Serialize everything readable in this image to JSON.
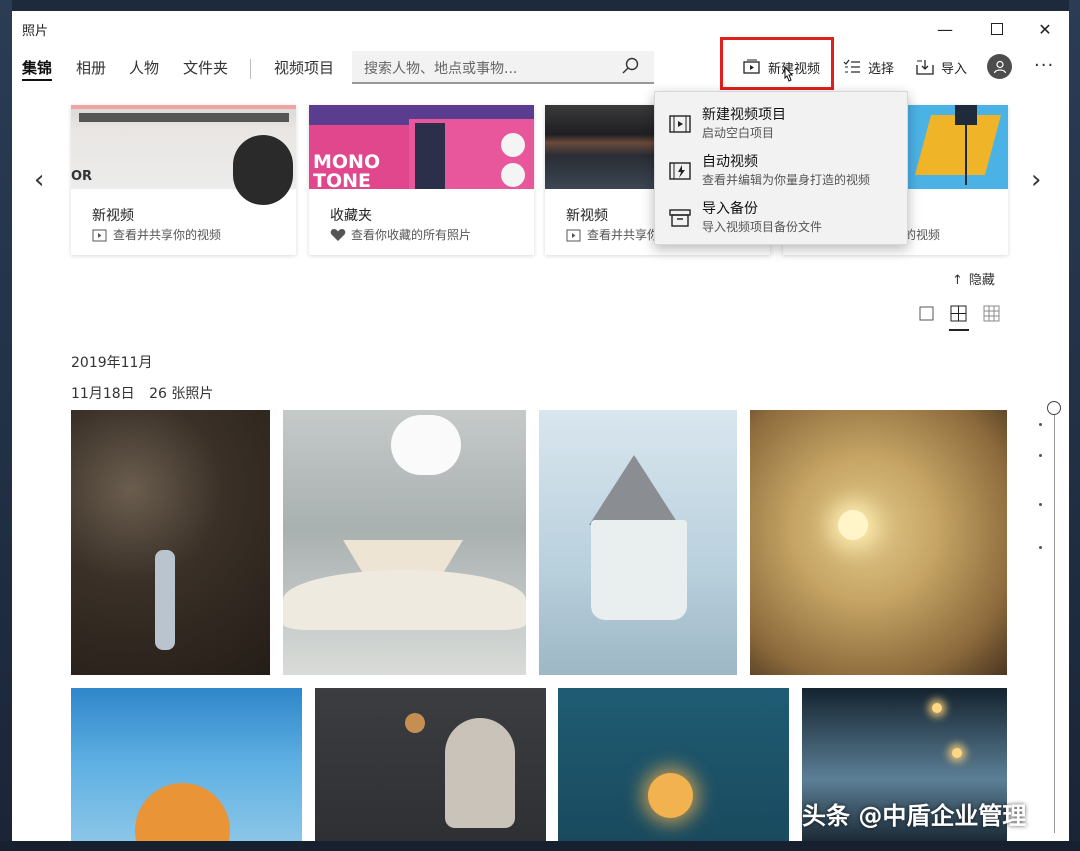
{
  "window": {
    "title": "照片",
    "minimize_glyph": "—",
    "maximize_glyph": "☐",
    "close_glyph": "✕"
  },
  "nav": {
    "tabs": [
      {
        "label": "集锦",
        "active": true
      },
      {
        "label": "相册"
      },
      {
        "label": "人物"
      },
      {
        "label": "文件夹"
      },
      {
        "label": "视频项目"
      }
    ],
    "search_placeholder": "搜索人物、地点或事物..."
  },
  "toolbar": {
    "new_video": "新建视频",
    "select": "选择",
    "import": "导入",
    "more_glyph": "···"
  },
  "carousel": {
    "prev_glyph": "‹",
    "next_glyph": "›",
    "cards": [
      {
        "title": "新视频",
        "subtitle": "查看并共享你的视频",
        "image_text": "OR"
      },
      {
        "title": "收藏夹",
        "subtitle": "查看你收藏的所有照片",
        "image_text": "MONO TONE"
      },
      {
        "title": "新视频",
        "subtitle": "查看并共享你的视频"
      },
      {
        "title": "",
        "subtitle": "的视频"
      }
    ]
  },
  "dropdown_menu": {
    "items": [
      {
        "title": "新建视频项目",
        "desc": "启动空白项目",
        "icon": "video-project-icon"
      },
      {
        "title": "自动视频",
        "desc": "查看并编辑为你量身打造的视频",
        "icon": "auto-video-icon"
      },
      {
        "title": "导入备份",
        "desc": "导入视频项目备份文件",
        "icon": "archive-icon"
      }
    ]
  },
  "hide_link": "隐藏",
  "collection": {
    "month": "2019年11月",
    "day": "11月18日",
    "count": "26 张照片"
  },
  "watermark": "头条 @中盾企业管理",
  "colors": {
    "highlight": "#e0201c",
    "accent": "#0063b1"
  }
}
